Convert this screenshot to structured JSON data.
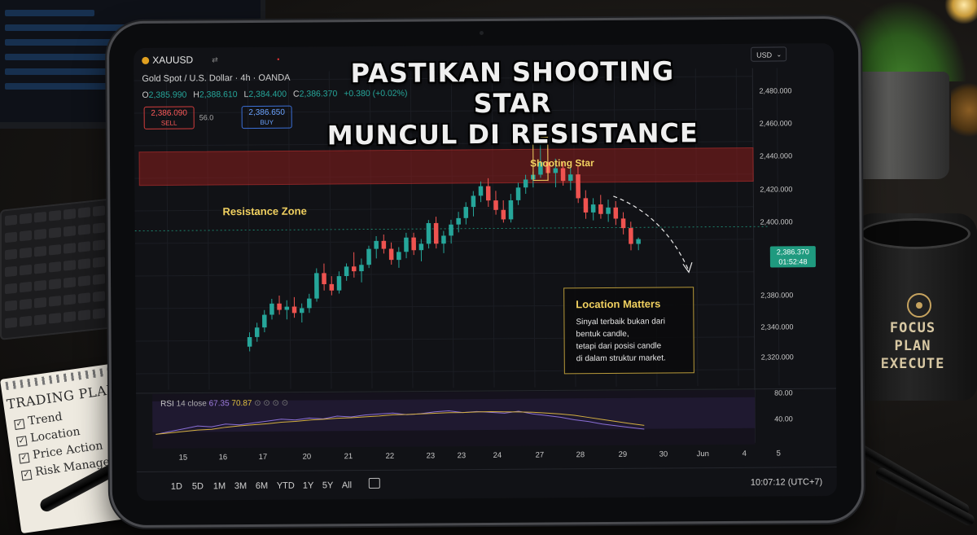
{
  "notepad": {
    "title": "TRADING PLAN",
    "items": [
      "Trend",
      "Location",
      "Price Action",
      "Risk Management"
    ]
  },
  "mug": {
    "line1": "FOCUS",
    "line2": "PLAN",
    "line3": "EXECUTE"
  },
  "headline": {
    "line1": "PASTIKAN SHOOTING STAR",
    "line2": "MUNCUL DI RESISTANCE"
  },
  "header": {
    "symbol": "XAUUSD",
    "description": "Gold Spot / U.S. Dollar · 4h · OANDA",
    "ohlc": {
      "o": "2,385.990",
      "h": "2,388.610",
      "l": "2,384.400",
      "c": "2,386.370",
      "change": "+0.380 (+0.02%)"
    },
    "sell_price": "2,386.090",
    "sell_label": "SELL",
    "spread": "56.0",
    "buy_price": "2,386.650",
    "buy_label": "BUY",
    "currency": "USD"
  },
  "annotations": {
    "resistance": "Resistance Zone",
    "shooting_star": "Shooting Star",
    "location_title": "Location Matters",
    "location_body_1": "Sinyal terbaik bukan dari",
    "location_body_2": "bentuk candle,",
    "location_body_3": "tetapi dari posisi candle",
    "location_body_4": "di dalam struktur market."
  },
  "price_tag": {
    "price": "2,386.370",
    "timer": "01:52:48"
  },
  "price_axis": [
    "2,480.000",
    "2,460.000",
    "2,440.000",
    "2,420.000",
    "2,400.000",
    "2,380.000",
    "2,340.000",
    "2,320.000"
  ],
  "rsi": {
    "label": "RSI",
    "params": "14 close",
    "v1": "67.35",
    "v2": "70.87",
    "axis_hi": "80.00",
    "axis_lo": "40.00"
  },
  "time_axis": [
    "15",
    "16",
    "17",
    "20",
    "21",
    "22",
    "23",
    "23",
    "24",
    "27",
    "28",
    "29",
    "30",
    "Jun",
    "4",
    "5"
  ],
  "timeframes": [
    "1D",
    "5D",
    "1M",
    "3M",
    "6M",
    "YTD",
    "1Y",
    "5Y",
    "All"
  ],
  "clock": "10:07:12 (UTC+7)",
  "colors": {
    "up": "#26a69a",
    "down": "#ef5350",
    "accent": "#f0d060",
    "zone": "#8a1e1e"
  },
  "chart_data": {
    "type": "candlestick",
    "candles": [
      {
        "o": 2313,
        "h": 2322,
        "l": 2310,
        "c": 2319
      },
      {
        "o": 2319,
        "h": 2328,
        "l": 2316,
        "c": 2325
      },
      {
        "o": 2325,
        "h": 2336,
        "l": 2322,
        "c": 2333
      },
      {
        "o": 2333,
        "h": 2343,
        "l": 2330,
        "c": 2340
      },
      {
        "o": 2340,
        "h": 2345,
        "l": 2333,
        "c": 2336
      },
      {
        "o": 2336,
        "h": 2342,
        "l": 2330,
        "c": 2338
      },
      {
        "o": 2338,
        "h": 2344,
        "l": 2331,
        "c": 2334
      },
      {
        "o": 2334,
        "h": 2340,
        "l": 2328,
        "c": 2337
      },
      {
        "o": 2337,
        "h": 2346,
        "l": 2334,
        "c": 2343
      },
      {
        "o": 2343,
        "h": 2362,
        "l": 2341,
        "c": 2359
      },
      {
        "o": 2359,
        "h": 2365,
        "l": 2348,
        "c": 2352
      },
      {
        "o": 2352,
        "h": 2357,
        "l": 2345,
        "c": 2348
      },
      {
        "o": 2348,
        "h": 2360,
        "l": 2346,
        "c": 2357
      },
      {
        "o": 2357,
        "h": 2365,
        "l": 2354,
        "c": 2363
      },
      {
        "o": 2363,
        "h": 2372,
        "l": 2356,
        "c": 2360
      },
      {
        "o": 2360,
        "h": 2368,
        "l": 2353,
        "c": 2364
      },
      {
        "o": 2364,
        "h": 2376,
        "l": 2362,
        "c": 2374
      },
      {
        "o": 2374,
        "h": 2382,
        "l": 2368,
        "c": 2379
      },
      {
        "o": 2379,
        "h": 2383,
        "l": 2371,
        "c": 2374
      },
      {
        "o": 2374,
        "h": 2378,
        "l": 2364,
        "c": 2367
      },
      {
        "o": 2367,
        "h": 2375,
        "l": 2362,
        "c": 2372
      },
      {
        "o": 2372,
        "h": 2384,
        "l": 2368,
        "c": 2381
      },
      {
        "o": 2381,
        "h": 2384,
        "l": 2370,
        "c": 2373
      },
      {
        "o": 2373,
        "h": 2380,
        "l": 2366,
        "c": 2377
      },
      {
        "o": 2377,
        "h": 2392,
        "l": 2374,
        "c": 2390
      },
      {
        "o": 2390,
        "h": 2394,
        "l": 2374,
        "c": 2377
      },
      {
        "o": 2377,
        "h": 2385,
        "l": 2371,
        "c": 2382
      },
      {
        "o": 2382,
        "h": 2392,
        "l": 2377,
        "c": 2389
      },
      {
        "o": 2389,
        "h": 2397,
        "l": 2384,
        "c": 2393
      },
      {
        "o": 2393,
        "h": 2403,
        "l": 2389,
        "c": 2400
      },
      {
        "o": 2400,
        "h": 2410,
        "l": 2394,
        "c": 2407
      },
      {
        "o": 2407,
        "h": 2416,
        "l": 2403,
        "c": 2413
      },
      {
        "o": 2413,
        "h": 2418,
        "l": 2400,
        "c": 2404
      },
      {
        "o": 2404,
        "h": 2410,
        "l": 2395,
        "c": 2398
      },
      {
        "o": 2398,
        "h": 2404,
        "l": 2390,
        "c": 2392
      },
      {
        "o": 2392,
        "h": 2408,
        "l": 2390,
        "c": 2404
      },
      {
        "o": 2404,
        "h": 2415,
        "l": 2401,
        "c": 2412
      },
      {
        "o": 2412,
        "h": 2420,
        "l": 2408,
        "c": 2417
      },
      {
        "o": 2417,
        "h": 2422,
        "l": 2412,
        "c": 2420
      },
      {
        "o": 2420,
        "h": 2442,
        "l": 2418,
        "c": 2428
      },
      {
        "o": 2428,
        "h": 2440,
        "l": 2416,
        "c": 2421
      },
      {
        "o": 2421,
        "h": 2430,
        "l": 2412,
        "c": 2424
      },
      {
        "o": 2424,
        "h": 2428,
        "l": 2413,
        "c": 2416
      },
      {
        "o": 2416,
        "h": 2424,
        "l": 2410,
        "c": 2420
      },
      {
        "o": 2420,
        "h": 2425,
        "l": 2402,
        "c": 2405
      },
      {
        "o": 2405,
        "h": 2410,
        "l": 2392,
        "c": 2396
      },
      {
        "o": 2396,
        "h": 2405,
        "l": 2391,
        "c": 2401
      },
      {
        "o": 2401,
        "h": 2407,
        "l": 2392,
        "c": 2395
      },
      {
        "o": 2395,
        "h": 2404,
        "l": 2390,
        "c": 2399
      },
      {
        "o": 2399,
        "h": 2403,
        "l": 2388,
        "c": 2392
      },
      {
        "o": 2392,
        "h": 2396,
        "l": 2382,
        "c": 2386
      },
      {
        "o": 2386,
        "h": 2390,
        "l": 2372,
        "c": 2376
      },
      {
        "o": 2376,
        "h": 2380,
        "l": 2372,
        "c": 2379
      }
    ],
    "resistance_zone": [
      2415,
      2436
    ],
    "shooting_star_index": 39,
    "current_price": 2386.37,
    "rsi_values": [
      44,
      47,
      50,
      53,
      52,
      55,
      54,
      56,
      58,
      60,
      59,
      61,
      60,
      63,
      62,
      64,
      65,
      66,
      64,
      65,
      67,
      68,
      66,
      67,
      66,
      65,
      67,
      64,
      62,
      60,
      57,
      55,
      52,
      50,
      48,
      46
    ]
  }
}
